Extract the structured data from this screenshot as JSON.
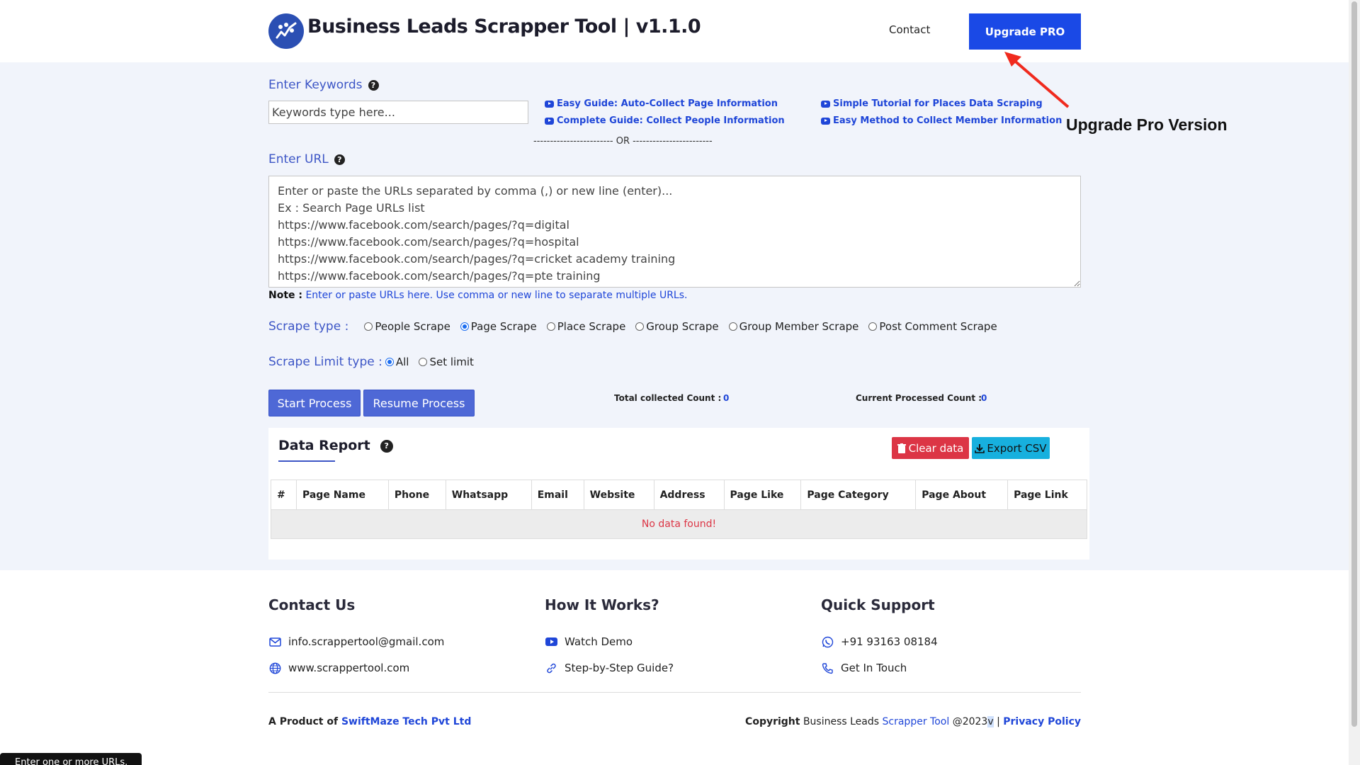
{
  "header": {
    "brand": "Business Leads Scrapper Tool | v1.1.0",
    "contact": "Contact",
    "upgrade": "Upgrade PRO",
    "annotation": "Upgrade Pro Version"
  },
  "keywords": {
    "label": "Enter Keywords",
    "placeholder": "Keywords type here..."
  },
  "guides": [
    "Easy Guide: Auto-Collect Page Information",
    "Complete Guide: Collect People Information",
    "Simple Tutorial for Places Data Scraping",
    "Easy Method to Collect Member Information"
  ],
  "or_text": "------------------------ OR ------------------------",
  "url": {
    "label": "Enter URL",
    "placeholder": "Enter or paste the URLs separated by comma (,) or new line (enter)...\nEx : Search Page URLs list\nhttps://www.facebook.com/search/pages/?q=digital\nhttps://www.facebook.com/search/pages/?q=hospital\nhttps://www.facebook.com/search/pages/?q=cricket academy training\nhttps://www.facebook.com/search/pages/?q=pte training",
    "note_label": "Note :",
    "note_text": "Enter or paste URLs here. Use comma or new line to separate multiple URLs."
  },
  "scrape_type": {
    "label": "Scrape type :",
    "options": [
      "People Scrape",
      "Page Scrape",
      "Place Scrape",
      "Group Scrape",
      "Group Member Scrape",
      "Post Comment Scrape"
    ],
    "selected": "Page Scrape"
  },
  "scrape_limit": {
    "label": "Scrape Limit type :",
    "options": [
      "All",
      "Set limit"
    ],
    "selected": "All"
  },
  "actions": {
    "start": "Start Process",
    "resume": "Resume Process"
  },
  "counts": {
    "total_label": "Total collected Count :",
    "total_value": "0",
    "processed_label": "Current Processed Count :",
    "processed_value": "0"
  },
  "report": {
    "title": "Data Report",
    "clear": "Clear data",
    "export": "Export CSV",
    "columns": [
      "#",
      "Page Name",
      "Phone",
      "Whatsapp",
      "Email",
      "Website",
      "Address",
      "Page Like",
      "Page Category",
      "Page About",
      "Page Link"
    ],
    "empty": "No data found!"
  },
  "footer": {
    "contact_heading": "Contact Us",
    "email": "info.scrappertool@gmail.com",
    "website": "www.scrappertool.com",
    "how_heading": "How It Works?",
    "watch_demo": "Watch Demo",
    "guide": "Step-by-Step Guide?",
    "support_heading": "Quick Support",
    "phone": "+91 93163 08184",
    "get_in_touch": "Get In Touch",
    "product_prefix": "A Product of",
    "company": "SwiftMaze Tech Pvt Ltd",
    "copyright_label": "Copyright",
    "copyright_brand": "Business Leads",
    "copyright_brand2": "Scrapper Tool",
    "copyright_year": "@2023",
    "copyright_v": "v",
    "separator": "|",
    "privacy": "Privacy Policy"
  },
  "tooltip": "Enter one or more URLs.",
  "colors": {
    "primary": "#1a49e6",
    "button": "#4e68d6",
    "danger": "#dc3545",
    "info": "#17b0de",
    "label": "#3d56c6"
  }
}
